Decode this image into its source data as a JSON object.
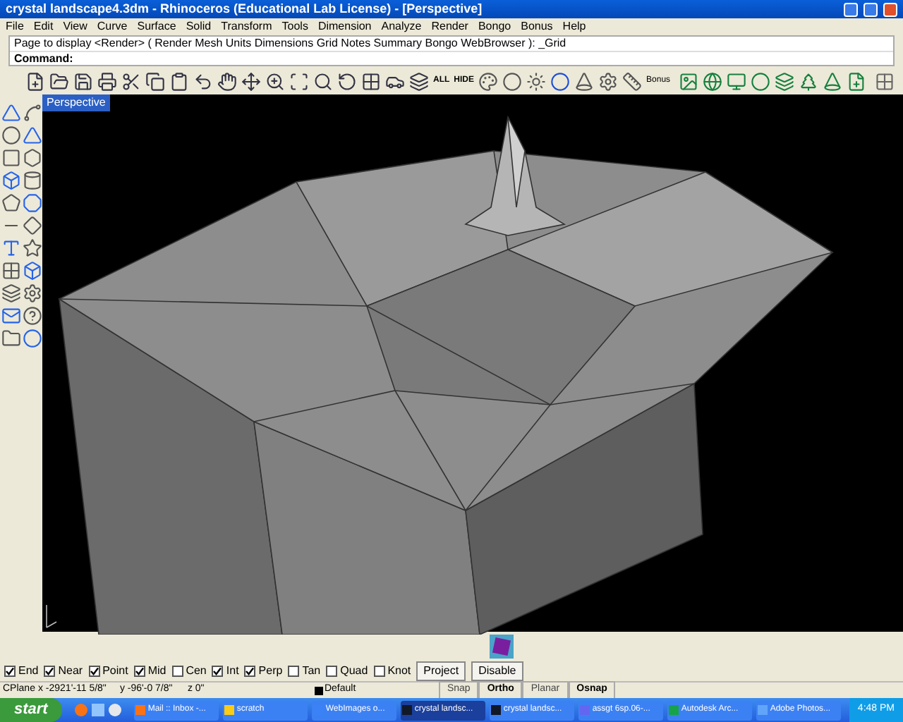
{
  "window": {
    "title": "crystal landscape4.3dm - Rhinoceros (Educational Lab License) - [Perspective]"
  },
  "menu": [
    "File",
    "Edit",
    "View",
    "Curve",
    "Surface",
    "Solid",
    "Transform",
    "Tools",
    "Dimension",
    "Analyze",
    "Render",
    "Bongo",
    "Bonus",
    "Help"
  ],
  "command_history": "Page to display <Render> ( Render Mesh Units Dimensions Grid Notes Summary Bongo WebBrowser ): _Grid",
  "command": {
    "label": "Command:"
  },
  "toolbar_text_buttons": [
    "ALL",
    "HIDE",
    "Bonus"
  ],
  "viewport": {
    "title": "Perspective"
  },
  "osnaps": [
    {
      "label": "End",
      "checked": true
    },
    {
      "label": "Near",
      "checked": true
    },
    {
      "label": "Point",
      "checked": true
    },
    {
      "label": "Mid",
      "checked": true
    },
    {
      "label": "Cen",
      "checked": false
    },
    {
      "label": "Int",
      "checked": true
    },
    {
      "label": "Perp",
      "checked": true
    },
    {
      "label": "Tan",
      "checked": false
    },
    {
      "label": "Quad",
      "checked": false
    },
    {
      "label": "Knot",
      "checked": false
    }
  ],
  "osnap_buttons": [
    "Project",
    "Disable"
  ],
  "status_bar": {
    "cplane": "CPlane",
    "x": "x -2921'-11 5/8\"",
    "y": "y -96'-0 7/8\"",
    "z": "z 0\"",
    "layer": "Default",
    "panes": [
      {
        "label": "Snap",
        "on": false
      },
      {
        "label": "Ortho",
        "on": true
      },
      {
        "label": "Planar",
        "on": false
      },
      {
        "label": "Osnap",
        "on": true
      }
    ]
  },
  "taskbar": {
    "start": "start",
    "tasks": [
      {
        "label": "Mail :: Inbox -...",
        "selected": false
      },
      {
        "label": "scratch",
        "selected": false
      },
      {
        "label": "WebImages o...",
        "selected": false
      },
      {
        "label": "crystal landsc...",
        "selected": true
      },
      {
        "label": "crystal landsc...",
        "selected": false
      },
      {
        "label": "assgt 6sp.06-...",
        "selected": false
      },
      {
        "label": "Autodesk Arc...",
        "selected": false
      },
      {
        "label": "Adobe Photos...",
        "selected": false
      }
    ],
    "clock": "4:48 PM"
  }
}
